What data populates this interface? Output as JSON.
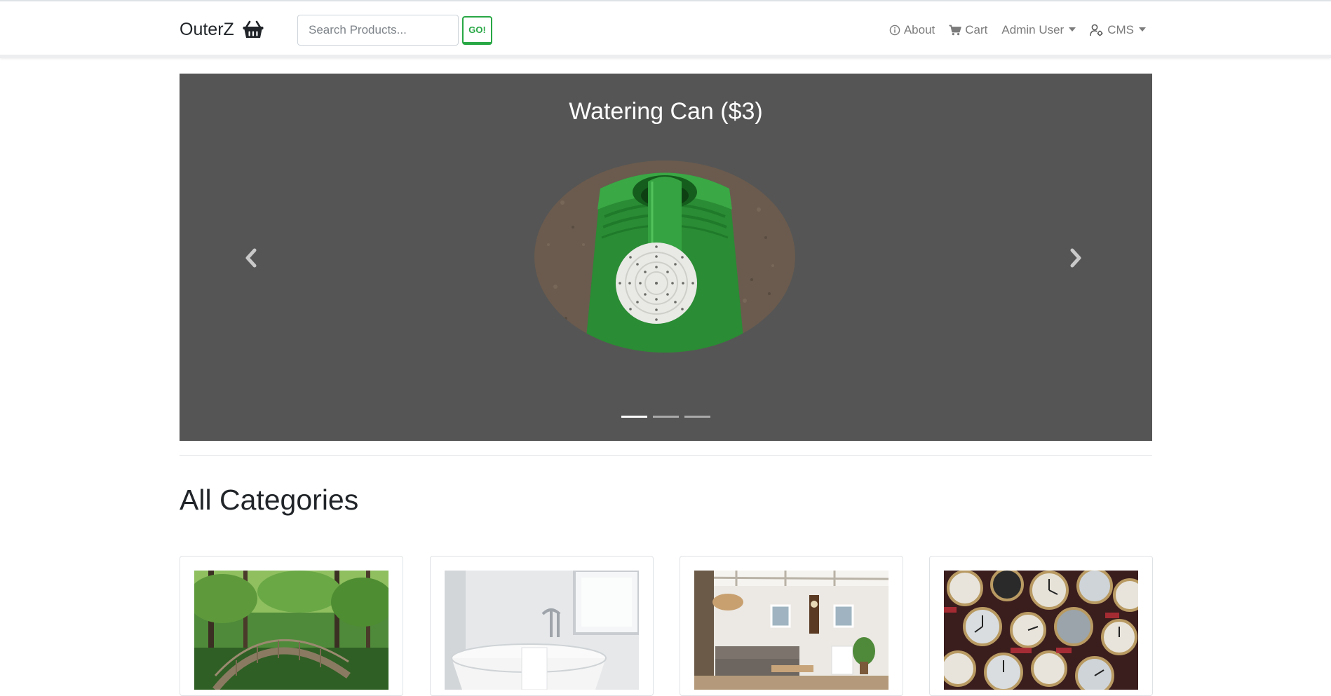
{
  "navbar": {
    "brand": "OuterZ",
    "brand_icon": "basket-icon",
    "search_placeholder": "Search Products...",
    "search_button": "GO!",
    "links": [
      {
        "label": "About",
        "icon": "info-circle-icon"
      },
      {
        "label": "Cart",
        "icon": "cart-icon"
      },
      {
        "label": "Admin User",
        "icon": "",
        "dropdown": true
      },
      {
        "label": "CMS",
        "icon": "user-cog-icon",
        "dropdown": true
      }
    ],
    "link_color": "#7b7b7b",
    "accent": "#28a745"
  },
  "carousel": {
    "slide_title": "Watering Can ($3)",
    "background": "#555555",
    "indicators": 3,
    "active_indicator": 1
  },
  "categories": {
    "heading": "All Categories",
    "items": [
      {
        "image": "garden-bridge-photo"
      },
      {
        "image": "bathtub-photo"
      },
      {
        "image": "living-room-photo"
      },
      {
        "image": "watches-photo"
      }
    ]
  }
}
